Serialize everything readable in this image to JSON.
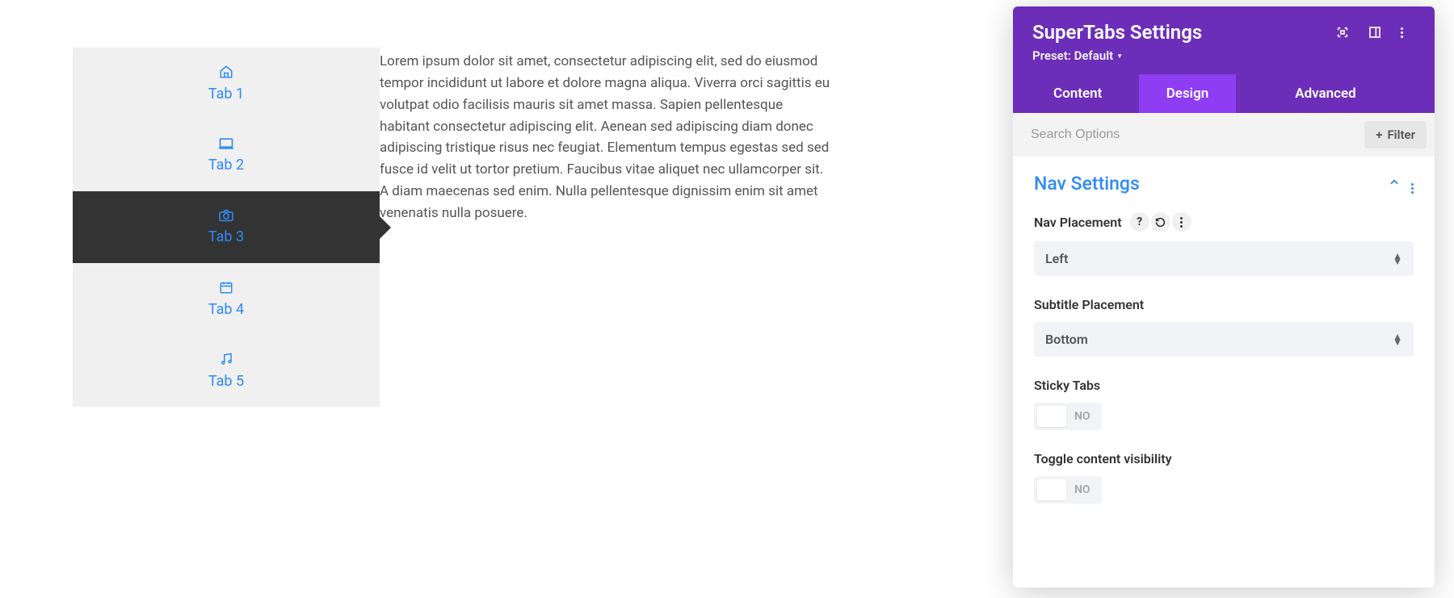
{
  "preview": {
    "tabs": [
      {
        "label": "Tab 1",
        "icon": "home-icon"
      },
      {
        "label": "Tab 2",
        "icon": "laptop-icon"
      },
      {
        "label": "Tab 3",
        "icon": "camera-icon",
        "active": true
      },
      {
        "label": "Tab 4",
        "icon": "calendar-icon"
      },
      {
        "label": "Tab 5",
        "icon": "music-icon"
      }
    ],
    "content": "Lorem ipsum dolor sit amet, consectetur adipiscing elit, sed do eiusmod tempor incididunt ut labore et dolore magna aliqua. Viverra orci sagittis eu volutpat odio facilisis mauris sit amet massa. Sapien pellentesque habitant consectetur adipiscing elit. Aenean sed adipiscing diam donec adipiscing tristique risus nec feugiat. Elementum tempus egestas sed sed fusce id velit ut tortor pretium. Faucibus vitae aliquet nec ullamcorper sit. A diam maecenas sed enim. Nulla pellentesque dignissim enim sit amet venenatis nulla posuere."
  },
  "panel": {
    "title": "SuperTabs Settings",
    "preset": "Preset: Default",
    "tabs": [
      {
        "key": "content",
        "label": "Content"
      },
      {
        "key": "design",
        "label": "Design",
        "active": true
      },
      {
        "key": "advanced",
        "label": "Advanced"
      }
    ],
    "search_placeholder": "Search Options",
    "filter_label": "Filter",
    "section": {
      "title": "Nav Settings",
      "fields": {
        "nav_placement": {
          "label": "Nav Placement",
          "value": "Left"
        },
        "subtitle_placement": {
          "label": "Subtitle Placement",
          "value": "Bottom"
        },
        "sticky_tabs": {
          "label": "Sticky Tabs",
          "value": "NO"
        },
        "toggle_visibility": {
          "label": "Toggle content visibility",
          "value": "NO"
        }
      }
    }
  }
}
